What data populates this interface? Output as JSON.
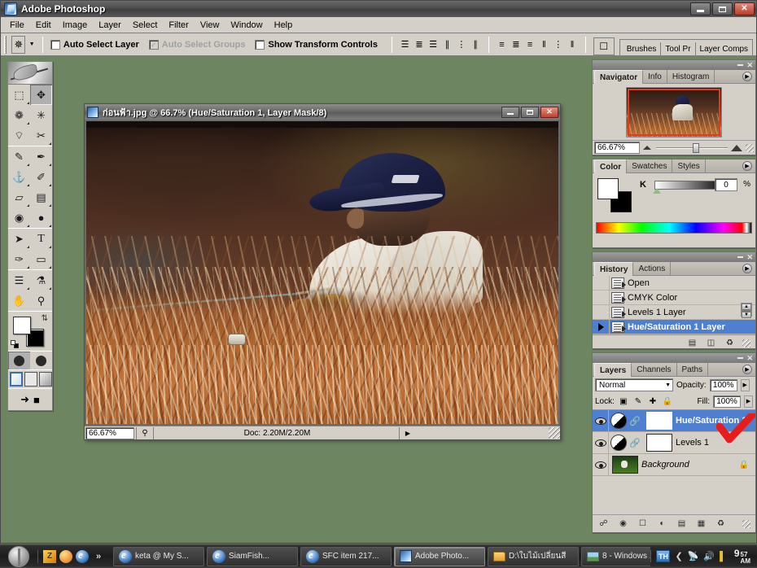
{
  "app": {
    "title": "Adobe Photoshop",
    "icon": "photoshop-icon"
  },
  "window_controls": {
    "minimize": "minimize-icon",
    "restore": "restore-icon",
    "close": "close-icon"
  },
  "menubar": {
    "items": [
      {
        "label": "File"
      },
      {
        "label": "Edit"
      },
      {
        "label": "Image"
      },
      {
        "label": "Layer"
      },
      {
        "label": "Select"
      },
      {
        "label": "Filter"
      },
      {
        "label": "View"
      },
      {
        "label": "Window"
      },
      {
        "label": "Help"
      }
    ]
  },
  "options_bar": {
    "tool_icon": "move-tool-icon",
    "tool_preset_arrow": "chevron-down-icon",
    "checkboxes": [
      {
        "label": "Auto Select Layer",
        "checked": false,
        "enabled": true
      },
      {
        "label": "Auto Select Groups",
        "checked": true,
        "enabled": false
      },
      {
        "label": "Show Transform Controls",
        "checked": false,
        "enabled": true
      }
    ],
    "align_icons": [
      "align-top-edges-icon",
      "align-vertical-centers-icon",
      "align-bottom-edges-icon",
      "align-left-edges-icon",
      "align-horizontal-centers-icon",
      "align-right-edges-icon"
    ],
    "distribute_icons": [
      "distribute-top-edges-icon",
      "distribute-vertical-centers-icon",
      "distribute-bottom-edges-icon",
      "distribute-left-edges-icon",
      "distribute-horizontal-centers-icon",
      "distribute-right-edges-icon"
    ],
    "imageready_icon": "jump-to-imageready-icon",
    "palette_well": [
      {
        "label": "Brushes"
      },
      {
        "label": "Tool Pr"
      },
      {
        "label": "Layer Comps"
      }
    ]
  },
  "toolbox": {
    "tools": [
      {
        "name": "rectangular-marquee-tool",
        "glyph": "⬚",
        "selected": false
      },
      {
        "name": "move-tool",
        "glyph": "✥",
        "selected": true
      },
      {
        "name": "lasso-tool",
        "glyph": "❁",
        "selected": false
      },
      {
        "name": "magic-wand-tool",
        "glyph": "✳",
        "selected": false
      },
      {
        "name": "crop-tool",
        "glyph": "⌔",
        "selected": false
      },
      {
        "name": "slice-tool",
        "glyph": "✂",
        "selected": false
      },
      {
        "name": "healing-brush-tool",
        "glyph": "✎",
        "selected": false
      },
      {
        "name": "brush-tool",
        "glyph": "✒",
        "selected": false
      },
      {
        "name": "clone-stamp-tool",
        "glyph": "⚓",
        "selected": false
      },
      {
        "name": "history-brush-tool",
        "glyph": "✐",
        "selected": false
      },
      {
        "name": "eraser-tool",
        "glyph": "▱",
        "selected": false
      },
      {
        "name": "gradient-tool",
        "glyph": "▤",
        "selected": false
      },
      {
        "name": "blur-tool",
        "glyph": "◉",
        "selected": false
      },
      {
        "name": "dodge-tool",
        "glyph": "●",
        "selected": false
      },
      {
        "name": "path-selection-tool",
        "glyph": "➤",
        "selected": false
      },
      {
        "name": "type-tool",
        "glyph": "T",
        "selected": false
      },
      {
        "name": "pen-tool",
        "glyph": "✑",
        "selected": false
      },
      {
        "name": "rectangle-shape-tool",
        "glyph": "▭",
        "selected": false
      },
      {
        "name": "notes-tool",
        "glyph": "☰",
        "selected": false
      },
      {
        "name": "eyedropper-tool",
        "glyph": "⚗",
        "selected": false
      },
      {
        "name": "hand-tool",
        "glyph": "✋",
        "selected": false
      },
      {
        "name": "zoom-tool",
        "glyph": "⚲",
        "selected": false
      }
    ],
    "foreground_color": "#ffffff",
    "background_color": "#000000",
    "swap_icon": "swap-colors-icon",
    "default_colors_icon": "default-colors-icon",
    "quick_mask": [
      {
        "name": "standard-mode-button",
        "active": true
      },
      {
        "name": "quick-mask-mode-button",
        "active": false
      }
    ],
    "screen_modes": [
      {
        "name": "standard-screen-mode-button",
        "active": true
      },
      {
        "name": "full-screen-with-menubar-button",
        "active": false
      },
      {
        "name": "full-screen-mode-button",
        "active": false
      }
    ],
    "jump_icon": "jump-to-imageready-icon"
  },
  "document": {
    "title": "ก่อนฟ้า.jpg @ 66.7% (Hue/Saturation 1, Layer Mask/8)",
    "icon": "document-icon",
    "status": {
      "zoom": "66.67%",
      "doc_size_label": "Doc: 2.20M/2.20M",
      "preview_icon": "preview-icon",
      "expand_arrow": "▶"
    },
    "window_controls": {
      "minimize": "minimize-icon",
      "restore": "restore-icon",
      "close": "close-icon"
    }
  },
  "navigator_palette": {
    "tabs": [
      {
        "label": "Navigator",
        "active": true
      },
      {
        "label": "Info",
        "active": false
      },
      {
        "label": "Histogram",
        "active": false
      }
    ],
    "menu_icon": "palette-menu-icon",
    "zoom_value": "66.67%",
    "zoom_out_icon": "zoom-out-icon",
    "zoom_in_icon": "zoom-in-icon",
    "view_box_color": "#e03a20"
  },
  "color_palette": {
    "tabs": [
      {
        "label": "Color",
        "active": true
      },
      {
        "label": "Swatches",
        "active": false
      },
      {
        "label": "Styles",
        "active": false
      }
    ],
    "menu_icon": "palette-menu-icon",
    "channel_label": "K",
    "channel_value": "0",
    "percent_symbol": "%",
    "foreground_color": "#ffffff",
    "background_color": "#000000"
  },
  "history_palette": {
    "tabs": [
      {
        "label": "History",
        "active": true
      },
      {
        "label": "Actions",
        "active": false
      }
    ],
    "menu_icon": "palette-menu-icon",
    "states": [
      {
        "label": "Open",
        "selected": false,
        "current": false
      },
      {
        "label": "CMYK Color",
        "selected": false,
        "current": false
      },
      {
        "label": "Levels 1 Layer",
        "selected": false,
        "current": false
      },
      {
        "label": "Hue/Saturation 1 Layer",
        "selected": true,
        "current": true
      }
    ],
    "footer_icons": [
      "create-document-from-state-icon",
      "create-new-snapshot-icon",
      "delete-state-icon"
    ],
    "minimize_icon": "minimize-icon",
    "close_icon": "close-icon"
  },
  "layers_palette": {
    "tabs": [
      {
        "label": "Layers",
        "active": true
      },
      {
        "label": "Channels",
        "active": false
      },
      {
        "label": "Paths",
        "active": false
      }
    ],
    "menu_icon": "palette-menu-icon",
    "blend_mode": "Normal",
    "opacity_label": "Opacity:",
    "opacity_value": "100%",
    "lock_label": "Lock:",
    "lock_icons": [
      "lock-transparent-pixels-icon",
      "lock-image-pixels-icon",
      "lock-position-icon",
      "lock-all-icon"
    ],
    "fill_label": "Fill:",
    "fill_value": "100%",
    "layers": [
      {
        "name": "Hue/Saturation 1",
        "selected": true,
        "visible": true,
        "type": "adjustment",
        "italic": false,
        "locked": false
      },
      {
        "name": "Levels 1",
        "selected": false,
        "visible": true,
        "type": "adjustment",
        "italic": false,
        "locked": false
      },
      {
        "name": "Background",
        "selected": false,
        "visible": true,
        "type": "image",
        "italic": true,
        "locked": true
      }
    ],
    "footer_icons": [
      "link-layers-icon",
      "layer-style-icon",
      "add-layer-mask-icon",
      "new-adjustment-layer-icon",
      "new-group-icon",
      "new-layer-icon",
      "delete-layer-icon"
    ],
    "minimize_icon": "minimize-icon",
    "close_icon": "close-icon"
  },
  "annotation": {
    "type": "red-check-mark",
    "color": "#e81c18"
  },
  "taskbar": {
    "start_icon": "start-button-icon",
    "quick_launch": [
      {
        "name": "quicklaunch-app-icon"
      },
      {
        "name": "quicklaunch-media-icon"
      },
      {
        "name": "quicklaunch-ie-icon"
      },
      {
        "name": "quicklaunch-more-icon",
        "label": "»"
      }
    ],
    "tasks": [
      {
        "label": "keta @ My S...",
        "icon": "ie-icon",
        "active": false
      },
      {
        "label": "SiamFish...",
        "icon": "ie-icon",
        "active": false
      },
      {
        "label": "SFC item 217...",
        "icon": "ie-icon",
        "active": false
      },
      {
        "label": "Adobe Photo...",
        "icon": "photoshop-icon",
        "active": true
      },
      {
        "label": "D:\\ใบไม้เปลี่ยนสี",
        "icon": "folder-icon",
        "active": false
      },
      {
        "label": "8 - Windows ...",
        "icon": "picture-icon",
        "active": false
      }
    ],
    "tray": {
      "language": "TH",
      "icons": [
        "chevron-left-icon",
        "network-icon",
        "volume-icon",
        "color-icon"
      ],
      "clock_hour": "9",
      "clock_minute": "57",
      "clock_period": "AM"
    }
  }
}
